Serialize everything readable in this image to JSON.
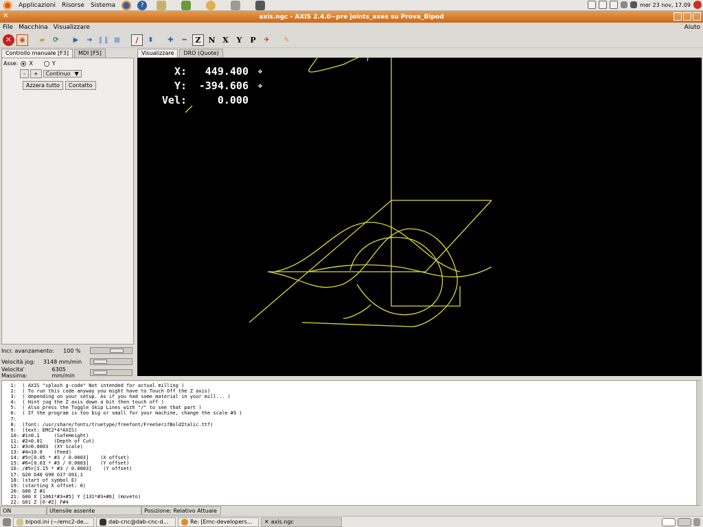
{
  "top_panel": {
    "menus": [
      "Applicazioni",
      "Risorse",
      "Sistema"
    ],
    "clock": "mer 23 nov, 17.09"
  },
  "window": {
    "title": "axis.ngc - AXIS 2.4.0~pre joints_axes su Prova_Bipod"
  },
  "menubar": {
    "items": [
      "File",
      "Macchina",
      "Visualizzare"
    ],
    "help": "Aiuto"
  },
  "toolbar": {
    "axis_buttons": [
      "Z",
      "N",
      "X",
      "Y",
      "P"
    ]
  },
  "left_tabs": [
    "Controllo manuale [F3]",
    "MDI [F5]"
  ],
  "manual": {
    "axis_label": "Asse:",
    "axis_x": "X",
    "axis_y": "Y",
    "minus": "-",
    "plus": "+",
    "jog_mode": "Continuo",
    "zero_button": "Azzera tutto",
    "touch_button": "Contatto"
  },
  "sliders": [
    {
      "label": "Incr. avanzamento:",
      "value": "100 %",
      "level": 0.7
    },
    {
      "label": "Velocità jog:",
      "value": "3148 mm/min",
      "level": 0.1
    },
    {
      "label": "Velocita' Massima:",
      "value": "6305 mm/min",
      "level": 0.1
    }
  ],
  "preview_tabs": [
    "Visualizzare",
    "DRO (Quote)"
  ],
  "dro": {
    "x_label": "X:",
    "x_value": "449.400",
    "y_label": "Y:",
    "y_value": "-394.606",
    "vel_label": "Vel:",
    "vel_value": "0.000"
  },
  "code_lines": [
    "1:  ( AXIS \"splash g-code\" Not intended for actual milling )",
    "2:  ( To run this code anyway you might have to Touch Off the Z axis)",
    "3:  ( depending on your setup. As if you had some material in your mill... )",
    "4:  ( Hint jog the Z axis down a bit then touch off )",
    "5:  ( Also press the Toggle Skip Lines with \"/\" to see that part )",
    "6:  ( If the program is too big or small for your machine, change the scale #3 )",
    "7:",
    "8:  (font: /usr/share/fonts/truetype/freefont/FreeSerifBoldItalic.ttf)",
    "9:  (text: EMC2*4*AXIS)",
    "10: #1=0.1     (SafeHeight)",
    "11: #2=0.01    (Depth of Cut)",
    "12: #3=0.0003  (XY Scale)",
    "13: #4=10.0    (Feed)",
    "14: #5=[0.05 * #3 / 0.0003]    (X offset)",
    "15: #6=[0.03 * #3 / 0.0003]    (Y offset)",
    "16: /#5=[1.15 * #3 / 0.0003]    (Y offset)",
    "17: G20 G40 G90 G17 G91.1",
    "18: (start of symbol E)",
    "19: (starting X offset: 0)",
    "20: G00 Z #1",
    "21: G00 X [1061*#3+#5] Y [131*#3+#6] (moveto)",
    "22: G01 Z [0-#2] F#4"
  ],
  "status": {
    "state": "ON",
    "tool": "Utensile assente",
    "position": "Posizione: Relativo Attuale"
  },
  "taskbar": [
    "bipod.ini (~/emc2-de...",
    "dab-cnc@dab-cnc-d...",
    "Re: [Emc-developers...",
    "axis.ngc"
  ],
  "colors": {
    "toolpath": "#d9d934",
    "preview_bg": "#000000",
    "title_bar": "#d4782c"
  }
}
